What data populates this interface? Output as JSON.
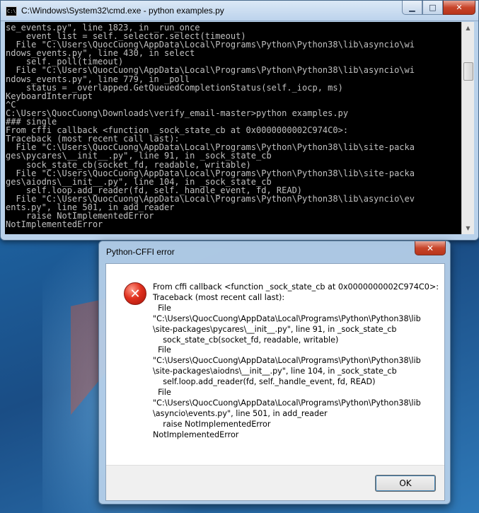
{
  "cmd_window": {
    "title": "C:\\Windows\\System32\\cmd.exe - python  examples.py",
    "icon_label": "C:\\",
    "controls": {
      "minimize": "▁",
      "maximize": "□",
      "close": "✕"
    },
    "console_lines": [
      "se_events.py\", line 1823, in _run_once",
      "    event_list = self._selector.select(timeout)",
      "  File \"C:\\Users\\QuocCuong\\AppData\\Local\\Programs\\Python\\Python38\\lib\\asyncio\\wi",
      "ndows_events.py\", line 430, in select",
      "    self._poll(timeout)",
      "  File \"C:\\Users\\QuocCuong\\AppData\\Local\\Programs\\Python\\Python38\\lib\\asyncio\\wi",
      "ndows_events.py\", line 779, in _poll",
      "    status = _overlapped.GetQueuedCompletionStatus(self._iocp, ms)",
      "KeyboardInterrupt",
      "^C",
      "C:\\Users\\QuocCuong\\Downloads\\verify_email-master>python examples.py",
      "### single",
      "From cffi callback <function _sock_state_cb at 0x0000000002C974C0>:",
      "Traceback (most recent call last):",
      "  File \"C:\\Users\\QuocCuong\\AppData\\Local\\Programs\\Python\\Python38\\lib\\site-packa",
      "ges\\pycares\\__init__.py\", line 91, in _sock_state_cb",
      "    sock_state_cb(socket_fd, readable, writable)",
      "  File \"C:\\Users\\QuocCuong\\AppData\\Local\\Programs\\Python\\Python38\\lib\\site-packa",
      "ges\\aiodns\\__init__.py\", line 104, in _sock_state_cb",
      "    self.loop.add_reader(fd, self._handle_event, fd, READ)",
      "  File \"C:\\Users\\QuocCuong\\AppData\\Local\\Programs\\Python\\Python38\\lib\\asyncio\\ev",
      "ents.py\", line 501, in add_reader",
      "    raise NotImplementedError",
      "NotImplementedError"
    ]
  },
  "dialog": {
    "title": "Python-CFFI error",
    "close_glyph": "✕",
    "icon_glyph": "✕",
    "message_lines": [
      "From cffi callback <function _sock_state_cb at 0x0000000002C974C0>:",
      "Traceback (most recent call last):",
      "  File",
      "\"C:\\Users\\QuocCuong\\AppData\\Local\\Programs\\Python\\Python38\\lib",
      "\\site-packages\\pycares\\__init__.py\", line 91, in _sock_state_cb",
      "    sock_state_cb(socket_fd, readable, writable)",
      "  File",
      "\"C:\\Users\\QuocCuong\\AppData\\Local\\Programs\\Python\\Python38\\lib",
      "\\site-packages\\aiodns\\__init__.py\", line 104, in _sock_state_cb",
      "    self.loop.add_reader(fd, self._handle_event, fd, READ)",
      "  File",
      "\"C:\\Users\\QuocCuong\\AppData\\Local\\Programs\\Python\\Python38\\lib",
      "\\asyncio\\events.py\", line 501, in add_reader",
      "    raise NotImplementedError",
      "NotImplementedError"
    ],
    "ok_label": "OK"
  },
  "colors": {
    "console_bg": "#000000",
    "console_text": "#c0c0c0",
    "error_red": "#e0301e",
    "desktop_blue": "#1d5f9c"
  }
}
